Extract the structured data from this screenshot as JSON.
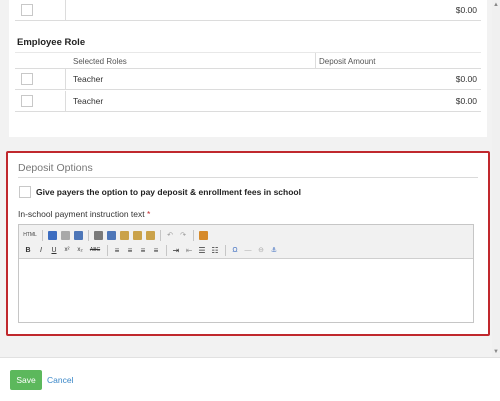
{
  "top_row": {
    "amount": "$0.00"
  },
  "employee_role": {
    "title": "Employee Role",
    "columns": [
      "Selected Roles",
      "Deposit Amount"
    ],
    "rows": [
      {
        "role": "Teacher",
        "amount": "$0.00"
      },
      {
        "role": "Teacher",
        "amount": "$0.00"
      }
    ]
  },
  "deposit_options": {
    "title": "Deposit Options",
    "option_label": "Give payers the option to pay deposit & enrollment fees in school",
    "instruction_label": "In-school payment instruction text",
    "required_marker": "*",
    "editor": {
      "toolbar_row1": [
        "source-icon",
        "spellcheck-icon",
        "print-icon",
        "find-icon",
        "cut-icon",
        "copy-icon",
        "paste-icon",
        "paste-text-icon",
        "paste-word-icon",
        "undo-icon",
        "redo-icon",
        "edit-icon"
      ],
      "toolbar_row2": [
        "bold-icon",
        "italic-icon",
        "underline-icon",
        "superscript-icon",
        "subscript-icon",
        "strikethrough-icon",
        "align-left-icon",
        "align-center-icon",
        "align-right-icon",
        "justify-icon",
        "indent-icon",
        "outdent-icon",
        "ordered-list-icon",
        "bulleted-list-icon",
        "special-char-icon",
        "horizontal-rule-icon",
        "link-icon",
        "anchor-icon"
      ],
      "toolbar_glyphs": {
        "source": "HTML",
        "bold": "B",
        "italic": "I",
        "underline": "U",
        "superscript": "x²",
        "subscript": "x₂",
        "strike": "ABC",
        "omega": "Ω",
        "anchor": "⚓"
      },
      "value": ""
    }
  },
  "footer": {
    "save_label": "Save",
    "cancel_label": "Cancel"
  },
  "colors": {
    "accent_red": "#c0282d",
    "save_green": "#5cb85c",
    "link_blue": "#3a87c8"
  }
}
